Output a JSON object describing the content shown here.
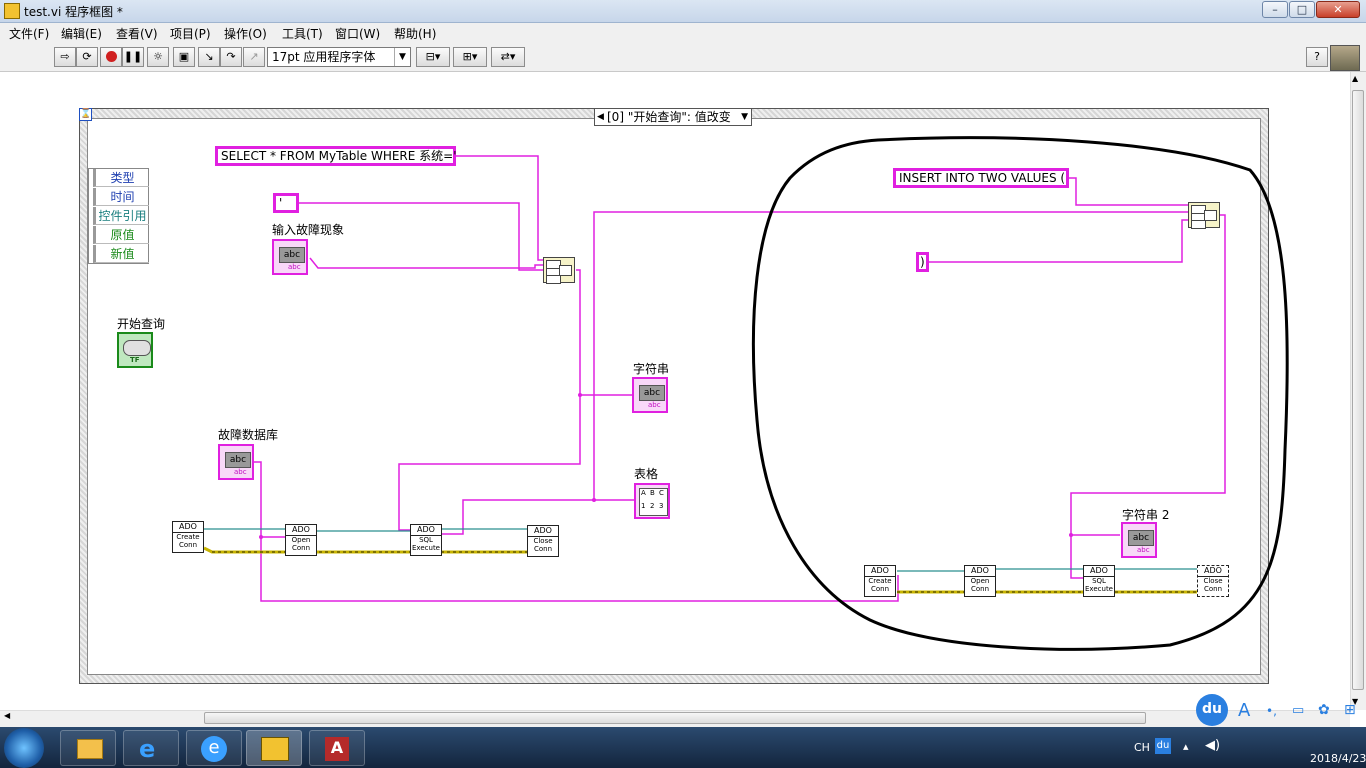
{
  "window": {
    "title": "test.vi 程序框图 *",
    "buttons": [
      "minimize",
      "maximize",
      "close"
    ]
  },
  "menu": [
    "文件(F)",
    "编辑(E)",
    "查看(V)",
    "项目(P)",
    "操作(O)",
    "工具(T)",
    "窗口(W)",
    "帮助(H)"
  ],
  "toolbar": {
    "font": "17pt 应用程序字体",
    "help_label": "?"
  },
  "diagram": {
    "case_selector": "[0] \"开始查询\": 值改变",
    "event_data": [
      "类型",
      "时间",
      "控件引用",
      "原值",
      "新值"
    ],
    "constants": {
      "select_sql": "SELECT * FROM MyTable WHERE 系统='",
      "quote": "'",
      "insert_sql": "INSERT INTO TWO VALUES (",
      "close_paren": ")"
    },
    "labels": {
      "input_fault": "输入故障现象",
      "start_query": "开始查询",
      "fault_db": "故障数据库",
      "string_ind": "字符串",
      "table_ind": "表格",
      "string2_ind": "字符串 2"
    },
    "terminal_text": {
      "abc": "abc",
      "abc_sub": "abc",
      "tf": "TF"
    },
    "ado_vis": [
      {
        "head": "ADO",
        "body": "Create Conn"
      },
      {
        "head": "ADO",
        "body": "Open Conn"
      },
      {
        "head": "ADO",
        "body": "SQL Execute"
      },
      {
        "head": "ADO",
        "body": "Close Conn"
      },
      {
        "head": "ADO",
        "body": "Create Conn"
      },
      {
        "head": "ADO",
        "body": "Open Conn"
      },
      {
        "head": "ADO",
        "body": "SQL Execute"
      },
      {
        "head": "ADO",
        "body": "Close Conn"
      }
    ],
    "table_cells": [
      "A",
      "B",
      "C",
      "1",
      "2",
      "3"
    ]
  },
  "taskbar": {
    "tray_lang": "CH",
    "tray_ime": "du",
    "clock_date": "2018/4/23",
    "ime_bar": [
      "du",
      "A"
    ]
  },
  "colors": {
    "string_wire": "#e020e0",
    "ref_wire": "#2a8f8f",
    "error_wire": "#c8b400",
    "bool_terminal": "#1a8a1a",
    "annotation": "#000000"
  }
}
